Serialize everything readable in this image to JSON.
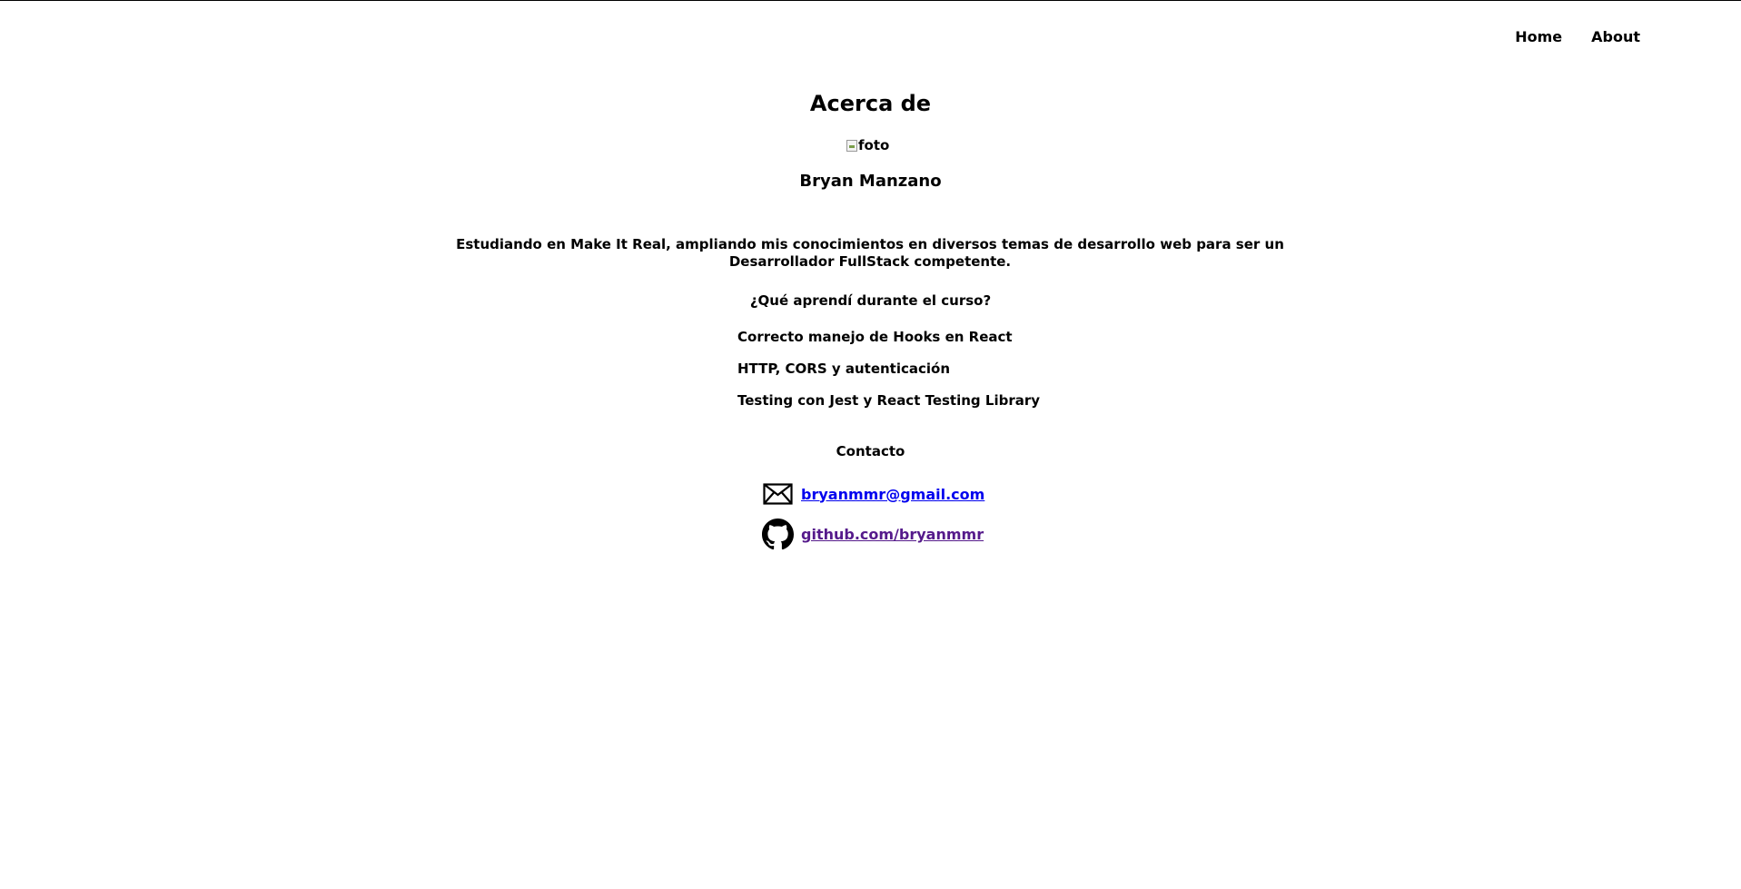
{
  "nav": {
    "home_label": "Home",
    "about_label": "About"
  },
  "page": {
    "title": "Acerca de",
    "photo_alt": "foto",
    "name": "Bryan Manzano",
    "bio": "Estudiando en Make It Real, ampliando mis conocimientos en diversos temas de desarrollo web para ser un Desarrollador FullStack competente."
  },
  "learned": {
    "title": "¿Qué aprendí durante el curso?",
    "items": [
      "Correcto manejo de Hooks en React",
      "HTTP, CORS y autenticación",
      "Testing con Jest y React Testing Library"
    ]
  },
  "contact": {
    "title": "Contacto",
    "email": {
      "icon": "envelope-icon",
      "label": "bryanmmr@gmail.com",
      "color": "#0000ee"
    },
    "github": {
      "icon": "github-icon",
      "label": "github.com/bryanmmr",
      "color": "#551a8b"
    }
  }
}
